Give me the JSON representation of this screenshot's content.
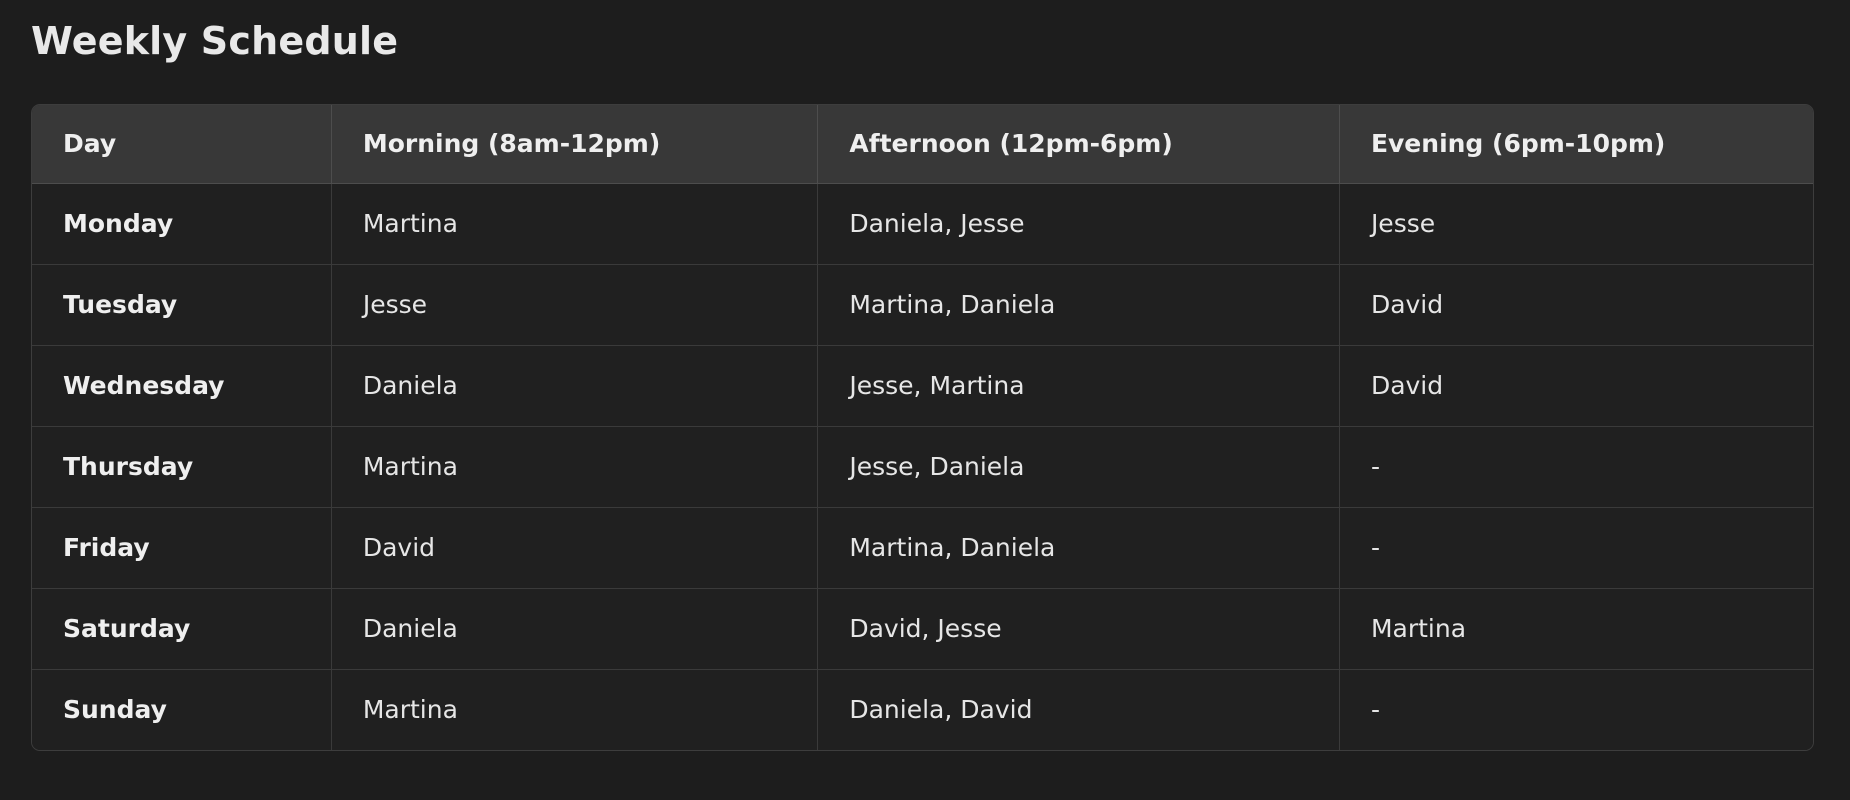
{
  "page": {
    "title": "Weekly Schedule",
    "background_color": "#1d1d1d",
    "text_color": "#e8e8e8"
  },
  "table": {
    "header_background": "#383838",
    "body_background": "#202020",
    "border_color": "#3d3d3d",
    "columns": [
      {
        "key": "day",
        "label": "Day"
      },
      {
        "key": "morning",
        "label": "Morning (8am-12pm)"
      },
      {
        "key": "afternoon",
        "label": "Afternoon (12pm-6pm)"
      },
      {
        "key": "evening",
        "label": "Evening (6pm-10pm)"
      }
    ],
    "rows": [
      {
        "day": "Monday",
        "morning": "Martina",
        "afternoon": "Daniela, Jesse",
        "evening": "Jesse"
      },
      {
        "day": "Tuesday",
        "morning": "Jesse",
        "afternoon": "Martina, Daniela",
        "evening": "David"
      },
      {
        "day": "Wednesday",
        "morning": "Daniela",
        "afternoon": "Jesse, Martina",
        "evening": "David"
      },
      {
        "day": "Thursday",
        "morning": "Martina",
        "afternoon": "Jesse, Daniela",
        "evening": "-"
      },
      {
        "day": "Friday",
        "morning": "David",
        "afternoon": "Martina, Daniela",
        "evening": "-"
      },
      {
        "day": "Saturday",
        "morning": "Daniela",
        "afternoon": "David, Jesse",
        "evening": "Martina"
      },
      {
        "day": "Sunday",
        "morning": "Martina",
        "afternoon": "Daniela, David",
        "evening": "-"
      }
    ]
  }
}
